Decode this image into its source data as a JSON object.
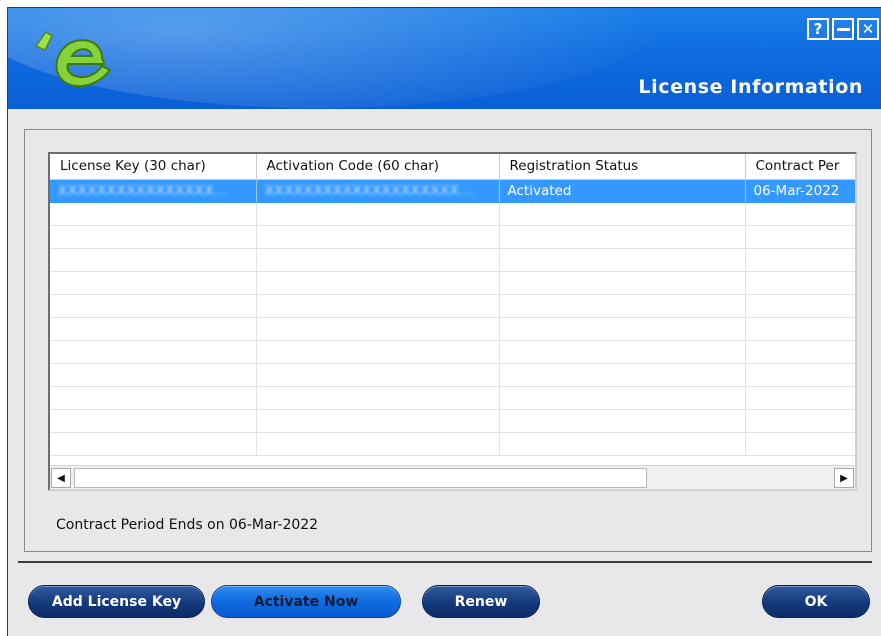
{
  "window": {
    "title": "License Information",
    "help_glyph": "?",
    "close_glyph": "✕"
  },
  "table": {
    "columns": [
      "License Key (30 char)",
      "Activation Code (60 char)",
      "Registration Status",
      "Contract Per"
    ],
    "rows": [
      {
        "license_key": "XXXXXXXXXXXXXXXX...",
        "activation_code": "XXXXXXXXXXXXXXXXXXXX...",
        "registration_status": "Activated",
        "contract_period": "06-Mar-2022"
      }
    ]
  },
  "scrollbar": {
    "left_arrow": "◀",
    "right_arrow": "▶"
  },
  "footer_text": "Contract Period Ends on 06-Mar-2022",
  "buttons": {
    "add_license_key": "Add License Key",
    "activate_now": "Activate Now",
    "renew": "Renew",
    "ok": "OK"
  },
  "colors": {
    "title_bar": "#0f6ce0",
    "selection": "#3399ff",
    "button_dark": "#153a7c",
    "button_primary": "#0e6ce0",
    "logo_green": "#7cc63a"
  }
}
